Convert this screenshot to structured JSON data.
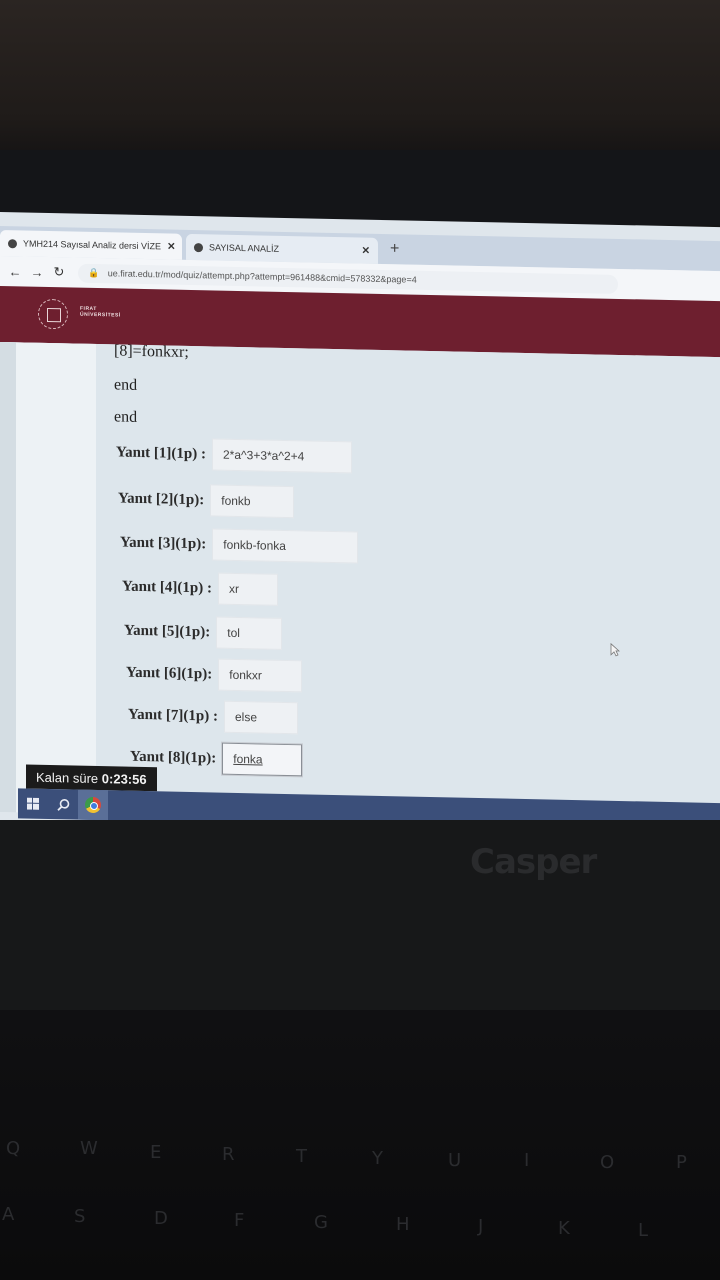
{
  "browser": {
    "tabs": [
      {
        "label": "YMH214 Sayısal Analiz dersi VİZE",
        "active": true
      },
      {
        "label": "SAYISAL ANALİZ",
        "active": false
      }
    ],
    "url": "ue.firat.edu.tr/mod/quiz/attempt.php?attempt=961488&cmid=578332&page=4"
  },
  "site": {
    "logo_line1": "FIRAT",
    "logo_line2": "ÜNİVERSİTESİ"
  },
  "code_lines": [
    "[8]=fonkxr;",
    "end",
    "end"
  ],
  "answers": [
    {
      "label": "Yanıt [1](1p) :",
      "value": "2*a^3+3*a^2+4"
    },
    {
      "label": "Yanıt [2](1p):",
      "value": "fonkb"
    },
    {
      "label": "Yanıt [3](1p):",
      "value": "fonkb-fonka"
    },
    {
      "label": "Yanıt [4](1p) :",
      "value": "xr"
    },
    {
      "label": "Yanıt [5](1p):",
      "value": "tol"
    },
    {
      "label": "Yanıt [6](1p):",
      "value": "fonkxr"
    },
    {
      "label": "Yanıt [7](1p) :",
      "value": "else"
    },
    {
      "label": "Yanıt [8](1p):",
      "value": "fonka"
    }
  ],
  "timer": {
    "label": "Kalan süre",
    "value": "0:23:56"
  },
  "laptop_brand": "Casper",
  "keyboard": {
    "row1": [
      "Q",
      "W",
      "E",
      "R",
      "T",
      "Y",
      "U",
      "I",
      "O",
      "P"
    ],
    "row2": [
      "A",
      "S",
      "D",
      "F",
      "G",
      "H",
      "J",
      "K",
      "L"
    ]
  }
}
